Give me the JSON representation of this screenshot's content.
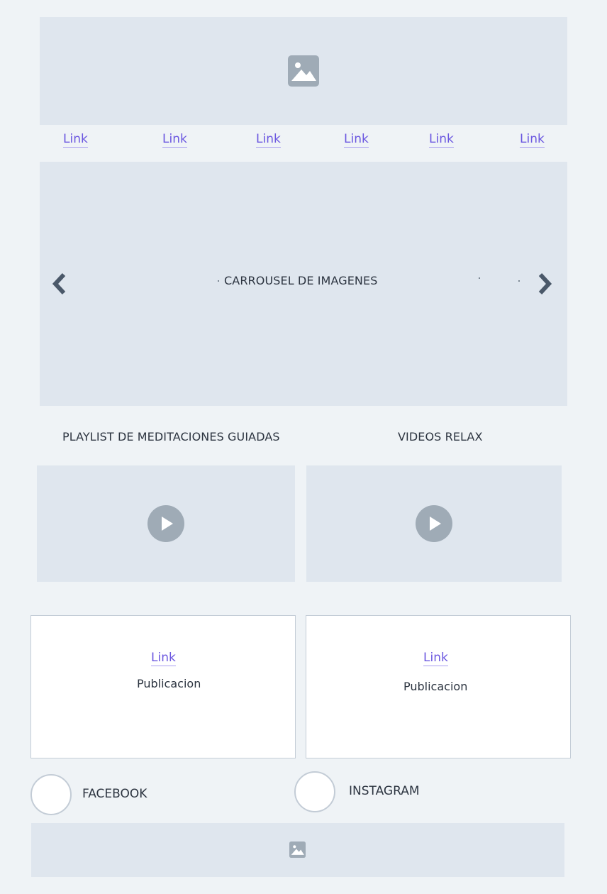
{
  "header": {
    "banner_icon": "image-icon"
  },
  "nav": {
    "links": [
      "Link",
      "Link",
      "Link",
      "Link",
      "Link",
      "Link"
    ]
  },
  "carousel": {
    "caption": "CARROUSEL DE IMAGENES",
    "prev_icon": "chevron-left-icon",
    "next_icon": "chevron-right-icon"
  },
  "videos": {
    "left_title": "PLAYLIST DE MEDITACIONES GUIADAS",
    "right_title": "VIDEOS RELAX",
    "play_icon": "play-icon"
  },
  "posts": {
    "left": {
      "link": "Link",
      "text": "Publicacion"
    },
    "right": {
      "link": "Link",
      "text": "Publicacion"
    }
  },
  "social": {
    "facebook": "FACEBOOK",
    "instagram": "INSTAGRAM"
  },
  "footer": {
    "icon": "image-icon"
  },
  "colors": {
    "background": "#eff3f6",
    "placeholder": "#dfe6ee",
    "link": "#6b57e0",
    "icon": "#9fabb6",
    "chevron": "#4a5869"
  }
}
